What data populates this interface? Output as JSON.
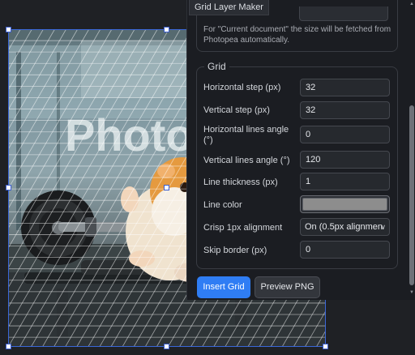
{
  "panel": {
    "tab_title": "Grid Layer Maker",
    "hint": "For \"Current document\" the size will be fetched from Photopea automatically.",
    "grid_legend": "Grid",
    "fields": {
      "horizontal_step": {
        "label": "Horizontal step (px)",
        "value": "32"
      },
      "vertical_step": {
        "label": "Vertical step (px)",
        "value": "32"
      },
      "horizontal_angle": {
        "label": "Horizontal lines angle (°)",
        "value": "0"
      },
      "vertical_angle": {
        "label": "Vertical lines angle (°)",
        "value": "120"
      },
      "line_thickness": {
        "label": "Line thickness (px)",
        "value": "1"
      },
      "line_color": {
        "label": "Line color",
        "value": "#8d8d8d"
      },
      "crisp_alignment": {
        "label": "Crisp 1px alignment",
        "value": "On (0.5px alignmen"
      },
      "skip_border": {
        "label": "Skip border (px)",
        "value": "0"
      }
    },
    "buttons": {
      "insert": "Insert Grid",
      "preview": "Preview PNG"
    }
  },
  "canvas": {
    "image_text": "Photo",
    "grid_color": "#ffffff"
  },
  "icons": {
    "scroll_up": "triangle-up-icon",
    "scroll_down": "triangle-down-icon",
    "select_chevron": "chevron-down-icon"
  }
}
